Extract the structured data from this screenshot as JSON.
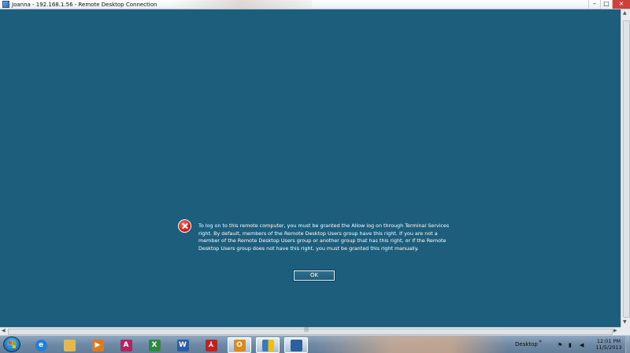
{
  "window": {
    "title": "Joanna - 192.168.1.56 - Remote Desktop Connection",
    "controls": {
      "minimize": "–",
      "maximize": "□",
      "close": "×"
    }
  },
  "dialog": {
    "message": "To log on to this remote computer, you must be granted the Allow log on through Terminal Services right. By default, members of the Remote Desktop Users group have this right. If you are not a member of the Remote Desktop Users group or another group that has this right, or if the Remote Desktop Users group does not have this right, you must be granted this right manually.",
    "ok_label": "OK",
    "icon": "error-icon"
  },
  "scrollbars": {
    "up_arrow": "▲",
    "down_arrow": "▼",
    "left_arrow": "◀",
    "right_arrow": "▶",
    "grip": "|||"
  },
  "taskbar": {
    "start": "windows-start-icon",
    "icons": [
      {
        "name": "internet-explorer-icon",
        "glyph": "e",
        "color": "#1f7fd6"
      },
      {
        "name": "windows-explorer-icon",
        "glyph": "",
        "color": "#e5b84a"
      },
      {
        "name": "media-player-icon",
        "glyph": "▶",
        "color": "#e07a1a"
      },
      {
        "name": "access-icon",
        "glyph": "A",
        "color": "#b5245f"
      },
      {
        "name": "excel-icon",
        "glyph": "X",
        "color": "#2b8a3e"
      },
      {
        "name": "word-icon",
        "glyph": "W",
        "color": "#2a5caa"
      },
      {
        "name": "acrobat-icon",
        "glyph": "⅄",
        "color": "#c81e1e"
      },
      {
        "name": "outlook-icon",
        "glyph": "O",
        "color": "#e08a12"
      },
      {
        "name": "security-shield-icon",
        "glyph": "",
        "color": "#3a78c4"
      },
      {
        "name": "remote-desktop-icon",
        "glyph": "",
        "color": "#2c5f9e"
      }
    ],
    "desktop_label": "Desktop",
    "chevron": "»",
    "clock_time": "12:01 PM",
    "clock_date": "11/5/2013"
  },
  "colors": {
    "remote_background": "#1d5e7c",
    "taskbar": "#6f8aa6"
  }
}
